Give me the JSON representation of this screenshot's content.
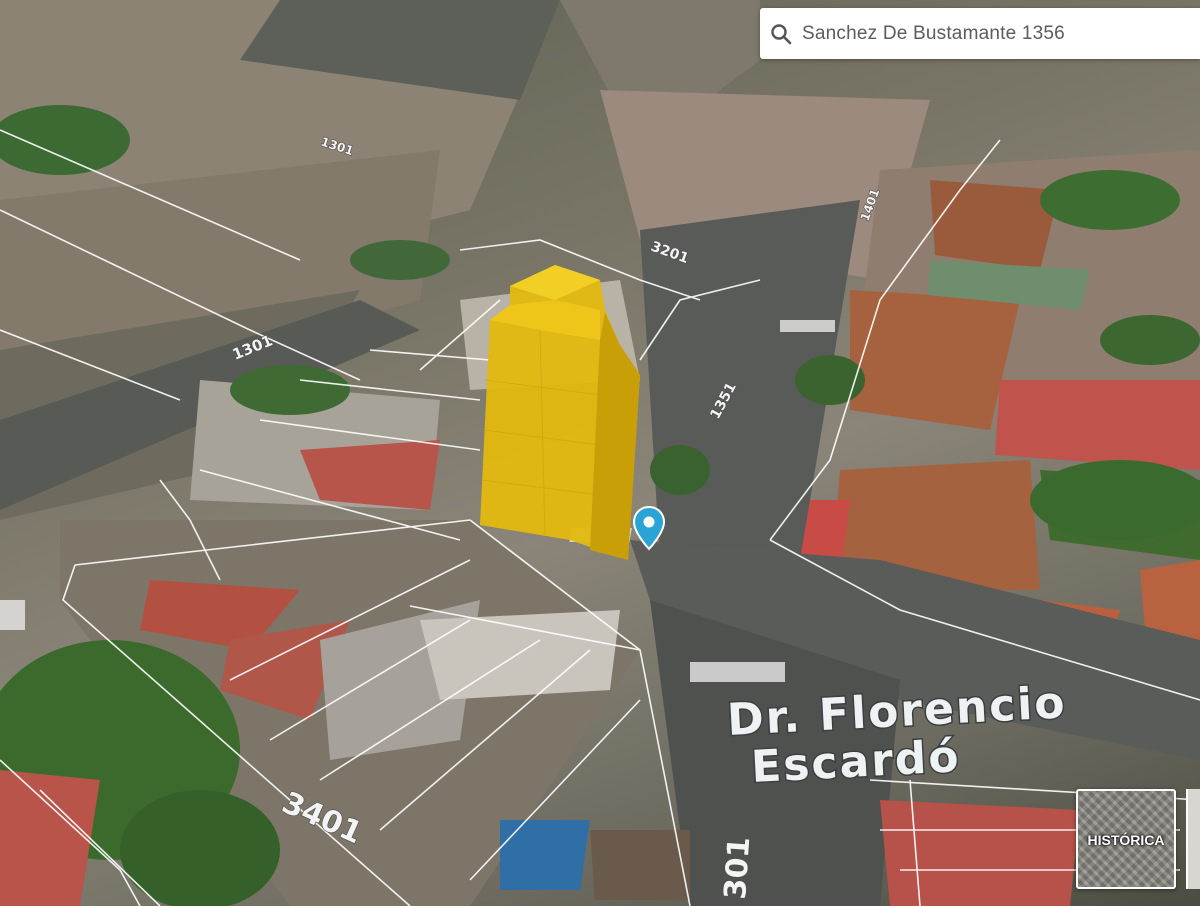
{
  "search": {
    "value": "Sanchez De Bustamante 1356",
    "placeholder": ""
  },
  "map": {
    "street_labels": {
      "a": "1301",
      "b": "3201",
      "c": "1351",
      "d": "1401",
      "e": "3401",
      "f": "301",
      "g": "1301"
    },
    "street_name_line1": "Dr. Florencio",
    "street_name_line2": "Escardó"
  },
  "historic_toggle": {
    "label": "HISTÓRICA"
  },
  "colors": {
    "building_extrusion": "#e3b90f",
    "pin": "#2aa4d6",
    "parcel_outline": "#ffffff"
  },
  "icons": {
    "search": "search-icon",
    "pin": "map-pin-icon"
  }
}
